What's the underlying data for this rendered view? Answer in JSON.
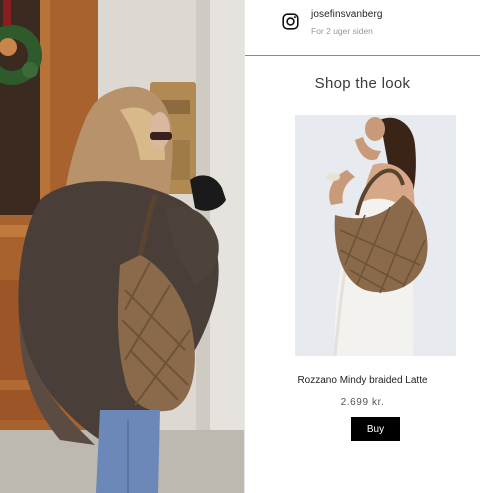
{
  "post": {
    "username": "josefinsvanberg",
    "time_ago": "For 2 uger siden",
    "icon": "instagram-icon"
  },
  "shop": {
    "title": "Shop the look",
    "product": {
      "name": "Rozzano Mindy braided Latte",
      "price": "2.699 kr.",
      "buy_label": "Buy"
    }
  },
  "colors": {
    "button_bg": "#000000",
    "button_text": "#ffffff",
    "bag": "#8a6a4a"
  }
}
